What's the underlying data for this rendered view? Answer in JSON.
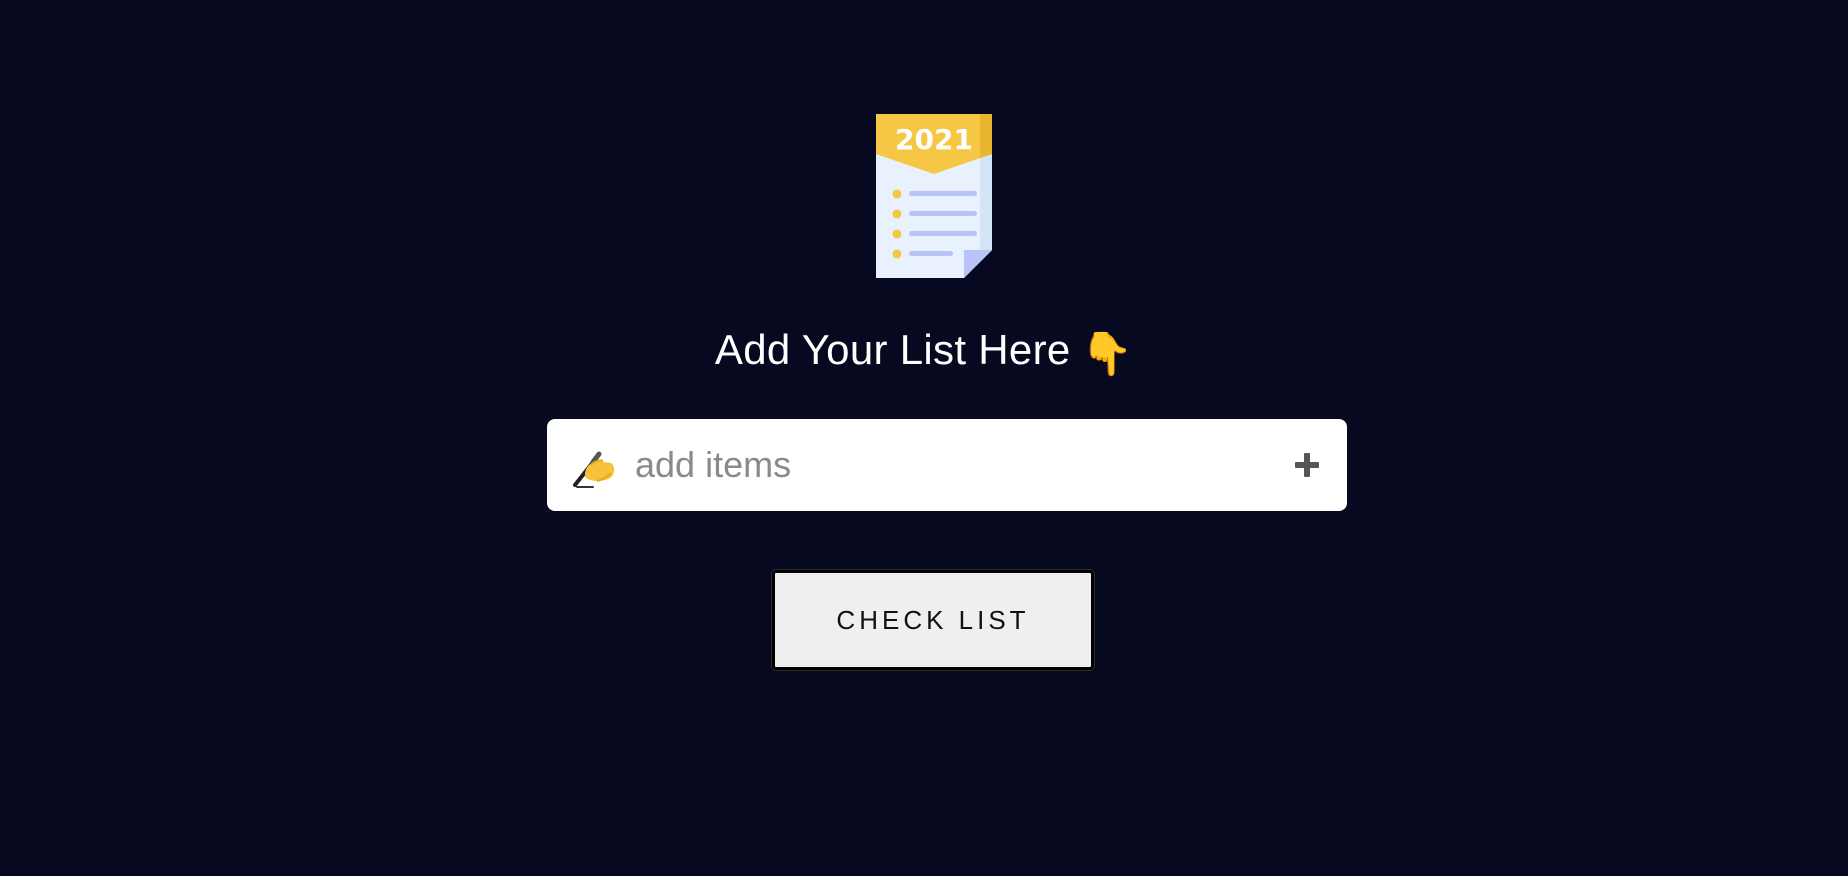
{
  "logo": {
    "icon": "checklist-document-icon",
    "year_label": "2021"
  },
  "heading": {
    "text": "Add Your List Here",
    "emoji": "👇"
  },
  "input": {
    "placeholder": "add items",
    "value": "",
    "leading_icon": "writing-hand-icon",
    "add_icon": "plus-icon"
  },
  "check_button": {
    "label": "CHECK LIST"
  },
  "colors": {
    "background": "#060920",
    "logo_yellow": "#F6C744",
    "paper": "#E8F1FD",
    "line_blue": "#B9C3F7"
  }
}
